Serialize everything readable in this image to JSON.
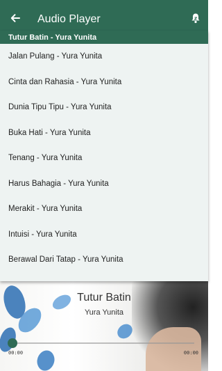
{
  "app": {
    "title": "Audio Player"
  },
  "icons": {
    "back": "arrow-left-icon",
    "notification": "bell-icon"
  },
  "colors": {
    "primary": "#2f6b55",
    "list_bg": "#eef3f2"
  },
  "tracklist": {
    "items": [
      {
        "label": "Tutur Batin - Yura Yunita",
        "active": true
      },
      {
        "label": "Jalan Pulang - Yura Yunita"
      },
      {
        "label": "Cinta dan Rahasia - Yura Yunita"
      },
      {
        "label": "Dunia Tipu Tipu - Yura Yunita"
      },
      {
        "label": "Buka Hati - Yura Yunita"
      },
      {
        "label": "Tenang - Yura Yunita"
      },
      {
        "label": "Harus Bahagia - Yura Yunita"
      },
      {
        "label": "Merakit - Yura Yunita"
      },
      {
        "label": "Intuisi - Yura Yunita"
      },
      {
        "label": "Berawal Dari Tatap - Yura Yunita"
      }
    ]
  },
  "now_playing": {
    "title": "Tutur Batin",
    "artist": "Yura Yunita",
    "elapsed": "00:00",
    "duration": "00:00",
    "progress": 0
  }
}
